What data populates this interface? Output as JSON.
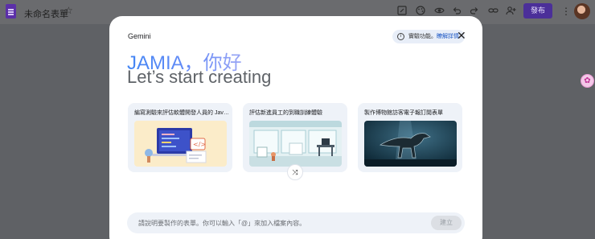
{
  "topbar": {
    "app_icon": "forms-icon",
    "doc_title": "未命名表單",
    "star_icon": "star-outline-icon",
    "toolbar_icons": [
      "customize-icon",
      "palette-icon",
      "preview-eye-icon",
      "undo-icon",
      "redo-icon",
      "link-icon",
      "add-person-icon"
    ],
    "send_label": "發布",
    "more_icon": "more-vert-icon"
  },
  "extension_icon": "extension-icon",
  "modal": {
    "label": "Gemini",
    "experimental_text": "實驗功能。",
    "experimental_link": "瞭解詳情",
    "close_icon": "close-icon",
    "greeting": "JAMIA，你好",
    "subtitle": "Let’s start creating",
    "cards": [
      {
        "title": "編寫測驗來評估軟體開發人員的 Java ...",
        "image": "code-screen-illustration"
      },
      {
        "title": "評估新進員工的到職訓練體驗",
        "image": "office-illustration"
      },
      {
        "title": "製作博物館訪客電子報訂閱表單",
        "image": "dinosaur-museum-photo"
      }
    ],
    "shuffle_icon": "shuffle-icon",
    "prompt_placeholder": "請說明要製作的表單。你可以輸入「@」來加入檔案內容。",
    "create_label": "建立"
  },
  "colors": {
    "accent_purple": "#4b2f99",
    "gemini_blue": "#4285f4",
    "card_bg": "#eef2f8"
  }
}
